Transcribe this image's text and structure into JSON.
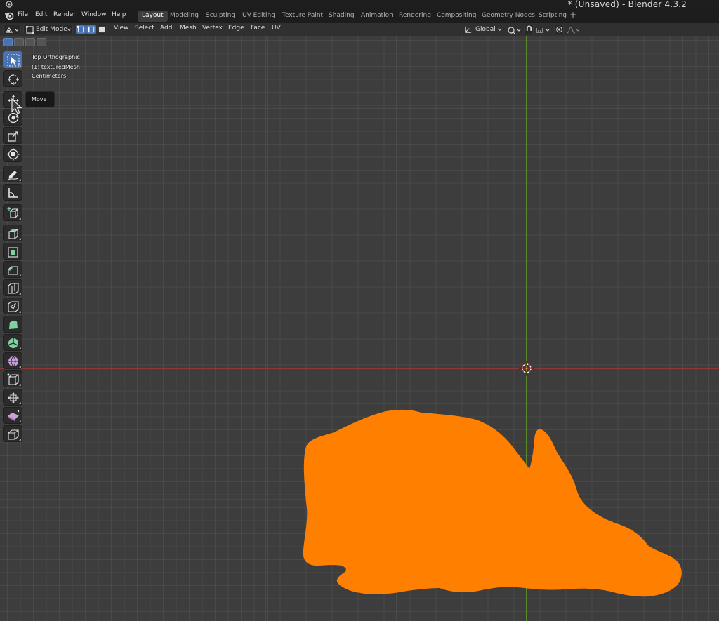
{
  "window": {
    "title": "* (Unsaved) - Blender 4.3.2"
  },
  "menu": {
    "items": [
      "File",
      "Edit",
      "Render",
      "Window",
      "Help"
    ]
  },
  "workspaces": {
    "tabs": [
      "Layout",
      "Modeling",
      "Sculpting",
      "UV Editing",
      "Texture Paint",
      "Shading",
      "Animation",
      "Rendering",
      "Compositing",
      "Geometry Nodes",
      "Scripting"
    ],
    "active": "Layout",
    "add_label": "+"
  },
  "viewport_header": {
    "mode": "Edit Mode",
    "menus": [
      "View",
      "Select",
      "Add",
      "Mesh",
      "Vertex",
      "Edge",
      "Face",
      "UV"
    ],
    "transform_orientation": "Global"
  },
  "viewport": {
    "overlay": {
      "view_name": "Top Orthographic",
      "object": "(1) texturedMesh",
      "units": "Centimeters"
    },
    "tooltip": "Move",
    "mesh_color": "#ff7f00",
    "x_axis_color": "#8f3838",
    "y_axis_color": "#5b8a2a"
  },
  "toolbar": {
    "tools": [
      {
        "name": "select-box",
        "active": true
      },
      {
        "name": "cursor"
      },
      {
        "name": "move"
      },
      {
        "name": "rotate"
      },
      {
        "name": "scale"
      },
      {
        "name": "transform"
      },
      {
        "name": "annotate"
      },
      {
        "name": "measure"
      },
      {
        "name": "add-cube"
      },
      {
        "name": "extrude-region"
      },
      {
        "name": "inset-faces"
      },
      {
        "name": "bevel"
      },
      {
        "name": "loop-cut"
      },
      {
        "name": "knife"
      },
      {
        "name": "poly-build"
      },
      {
        "name": "spin"
      },
      {
        "name": "smooth"
      },
      {
        "name": "edge-slide"
      },
      {
        "name": "shrink-fatten"
      },
      {
        "name": "shear"
      },
      {
        "name": "rip-region"
      }
    ]
  },
  "colors": {
    "accent": "#4772b3",
    "background": "#3d3d3d",
    "header": "#303030",
    "topbar": "#1d1d1d"
  }
}
